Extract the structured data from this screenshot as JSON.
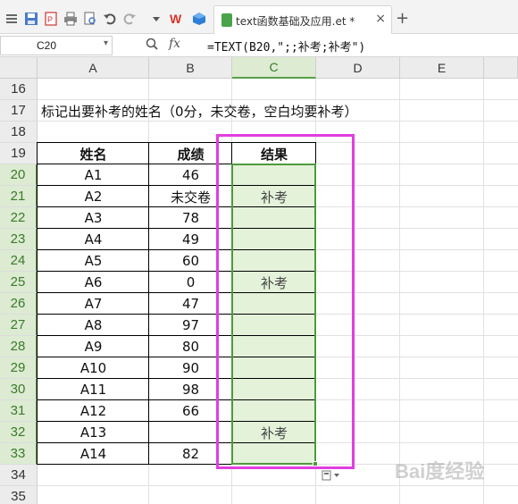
{
  "toolbar": {
    "icons": [
      "app-menu-icon",
      "save-icon",
      "pdf-export-icon",
      "print-icon",
      "print-preview-icon",
      "undo-icon",
      "redo-icon",
      "dropdown-icon",
      "wps-logo-icon",
      "cube-icon"
    ],
    "tab_title": "text函数基础及应用.et *",
    "close_glyph": "×",
    "new_tab_glyph": "+"
  },
  "formula_bar": {
    "name_box": "C20",
    "fx_label": "fx",
    "formula": "=TEXT(B20,\";;补考;补考\")"
  },
  "columns": [
    "A",
    "B",
    "C",
    "D",
    "E"
  ],
  "selected_column": "C",
  "rows": [
    "16",
    "17",
    "18",
    "19",
    "20",
    "21",
    "22",
    "23",
    "24",
    "25",
    "26",
    "27",
    "28",
    "29",
    "30",
    "31",
    "32",
    "33",
    "34",
    "35"
  ],
  "selected_rows": [
    "20",
    "21",
    "22",
    "23",
    "24",
    "25",
    "26",
    "27",
    "28",
    "29",
    "30",
    "31",
    "32",
    "33"
  ],
  "note_text": "标记出要补考的姓名（0分，未交卷，空白均要补考）",
  "table": {
    "headers": [
      "姓名",
      "成绩",
      "结果"
    ],
    "records": [
      [
        "A1",
        "46",
        ""
      ],
      [
        "A2",
        "未交卷",
        "补考"
      ],
      [
        "A3",
        "78",
        ""
      ],
      [
        "A4",
        "49",
        ""
      ],
      [
        "A5",
        "60",
        ""
      ],
      [
        "A6",
        "0",
        "补考"
      ],
      [
        "A7",
        "47",
        ""
      ],
      [
        "A8",
        "97",
        ""
      ],
      [
        "A9",
        "80",
        ""
      ],
      [
        "A10",
        "90",
        ""
      ],
      [
        "A11",
        "98",
        ""
      ],
      [
        "A12",
        "66",
        ""
      ],
      [
        "A13",
        "",
        "补考"
      ],
      [
        "A14",
        "82",
        ""
      ]
    ]
  },
  "colors": {
    "selection_fill": "#e3f2d9",
    "selection_border": "#4f9a3e",
    "highlight_border": "#e13ee0"
  },
  "watermark": "Bai度经验"
}
